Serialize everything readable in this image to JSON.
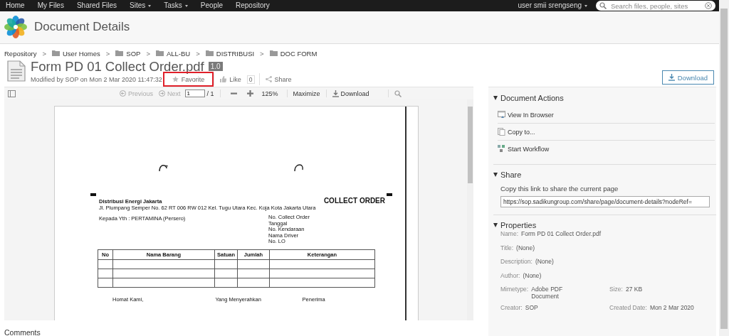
{
  "top_nav": {
    "items": [
      {
        "label": "Home",
        "has_menu": false
      },
      {
        "label": "My Files",
        "has_menu": false
      },
      {
        "label": "Shared Files",
        "has_menu": false
      },
      {
        "label": "Sites",
        "has_menu": true
      },
      {
        "label": "Tasks",
        "has_menu": true
      },
      {
        "label": "People",
        "has_menu": false
      },
      {
        "label": "Repository",
        "has_menu": false
      }
    ],
    "user": {
      "label": "user smii srengseng",
      "has_menu": true
    },
    "search": {
      "placeholder": "Search files, people, sites"
    }
  },
  "header": {
    "title": "Document Details"
  },
  "breadcrumb": {
    "separator": ">",
    "items": [
      {
        "label": "Repository",
        "folder": false
      },
      {
        "label": "User Homes",
        "folder": true
      },
      {
        "label": "SOP",
        "folder": true
      },
      {
        "label": "ALL-BU",
        "folder": true
      },
      {
        "label": "DISTRIBUSI",
        "folder": true
      },
      {
        "label": "DOC FORM",
        "folder": true
      }
    ]
  },
  "document": {
    "name": "Form PD 01 Collect Order.pdf",
    "version": "1.0",
    "modified": "Modified by SOP on Mon 2 Mar 2020 11:47:32",
    "favorite": {
      "label": "Favorite",
      "highlighted": true
    },
    "like": {
      "label": "Like",
      "count": "0"
    },
    "share": {
      "label": "Share"
    },
    "download": {
      "label": "Download"
    }
  },
  "viewer": {
    "toolbar": {
      "previous": {
        "label": "Previous",
        "disabled": true
      },
      "next": {
        "label": "Next",
        "disabled": true
      },
      "page": "1",
      "page_total": "/ 1",
      "zoom": "125%",
      "maximize": "Maximize",
      "download": "Download"
    },
    "pdf_page": {
      "company": "Distribusi Energi Jakarta",
      "address": "Jl. Plumpang Semper No. 62 RT 006 RW 012 Kel. Tugu Utara Kec. Koja Kota Jakarta Utara",
      "heading": "COLLECT ORDER",
      "recipient": "Kepada Yth  :  PERTAMINA (Persero)",
      "fields": [
        "No. Collect Order",
        "Tanggal",
        "No. Kendaraan",
        "Nama Driver",
        "No. LO"
      ],
      "table": {
        "columns": [
          "No",
          "Nama Barang",
          "Satuan",
          "Jumlah",
          "Keterangan"
        ],
        "rows": [
          {
            "kind": "blank"
          },
          {
            "kind": "blank"
          },
          {
            "kind": "blank"
          }
        ]
      },
      "signatures": [
        "Homat Kami,",
        "Yang Menyerahkan",
        "Penerima"
      ]
    }
  },
  "comments": {
    "title": "Comments"
  },
  "side_panel": {
    "document_actions": {
      "title": "Document Actions",
      "expanded": true,
      "items": [
        {
          "label": "View In Browser",
          "kind": "browser"
        },
        {
          "label": "Copy to...",
          "kind": "copy"
        },
        {
          "label": "Start Workflow",
          "kind": "workflow"
        }
      ]
    },
    "share": {
      "title": "Share",
      "expanded": true,
      "hint": "Copy this link to share the current page",
      "link": "https://sop.sadikungroup.com/share/page/document-details?nodeRef="
    },
    "properties": {
      "title": "Properties",
      "expanded": true,
      "rows": [
        [
          {
            "label": "Name:",
            "value": "Form PD 01 Collect Order.pdf"
          }
        ],
        [
          {
            "label": "Title:",
            "value": "(None)"
          }
        ],
        [
          {
            "label": "Description:",
            "value": "(None)"
          }
        ],
        [
          {
            "label": "Author:",
            "value": "(None)"
          }
        ],
        [
          {
            "label": "Mimetype:",
            "value": "Adobe PDF Document"
          },
          {
            "label": "Size:",
            "value": "27 KB"
          }
        ],
        [
          {
            "label": "Creator:",
            "value": "SOP"
          },
          {
            "label": "Created Date:",
            "value": "Mon 2 Mar 2020"
          }
        ]
      ]
    }
  }
}
